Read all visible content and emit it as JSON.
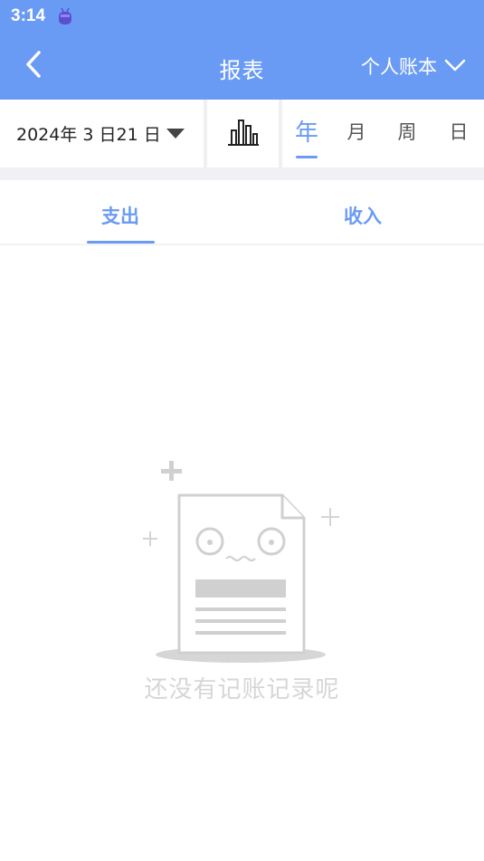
{
  "status_bar": {
    "time": "3:14"
  },
  "header": {
    "title": "报表",
    "book_selector": "个人账本"
  },
  "filter": {
    "date": "2024年 3 日21 日",
    "period_tabs": [
      "年",
      "月",
      "周",
      "日"
    ],
    "active_period": "年"
  },
  "type_tabs": {
    "expense": "支出",
    "income": "收入",
    "active": "支出"
  },
  "empty_state": {
    "message": "还没有记账记录呢"
  },
  "colors": {
    "primary": "#6a9bf4",
    "empty_gray": "#d6d6d6",
    "band_gray": "#f0f0f5"
  },
  "icons": {
    "back": "chevron-left-icon",
    "book_dropdown": "chevron-down-icon",
    "date_dropdown": "triangle-down-icon",
    "chart": "bar-chart-icon",
    "status_app": "app-notification-icon",
    "empty": "empty-document-icon"
  }
}
